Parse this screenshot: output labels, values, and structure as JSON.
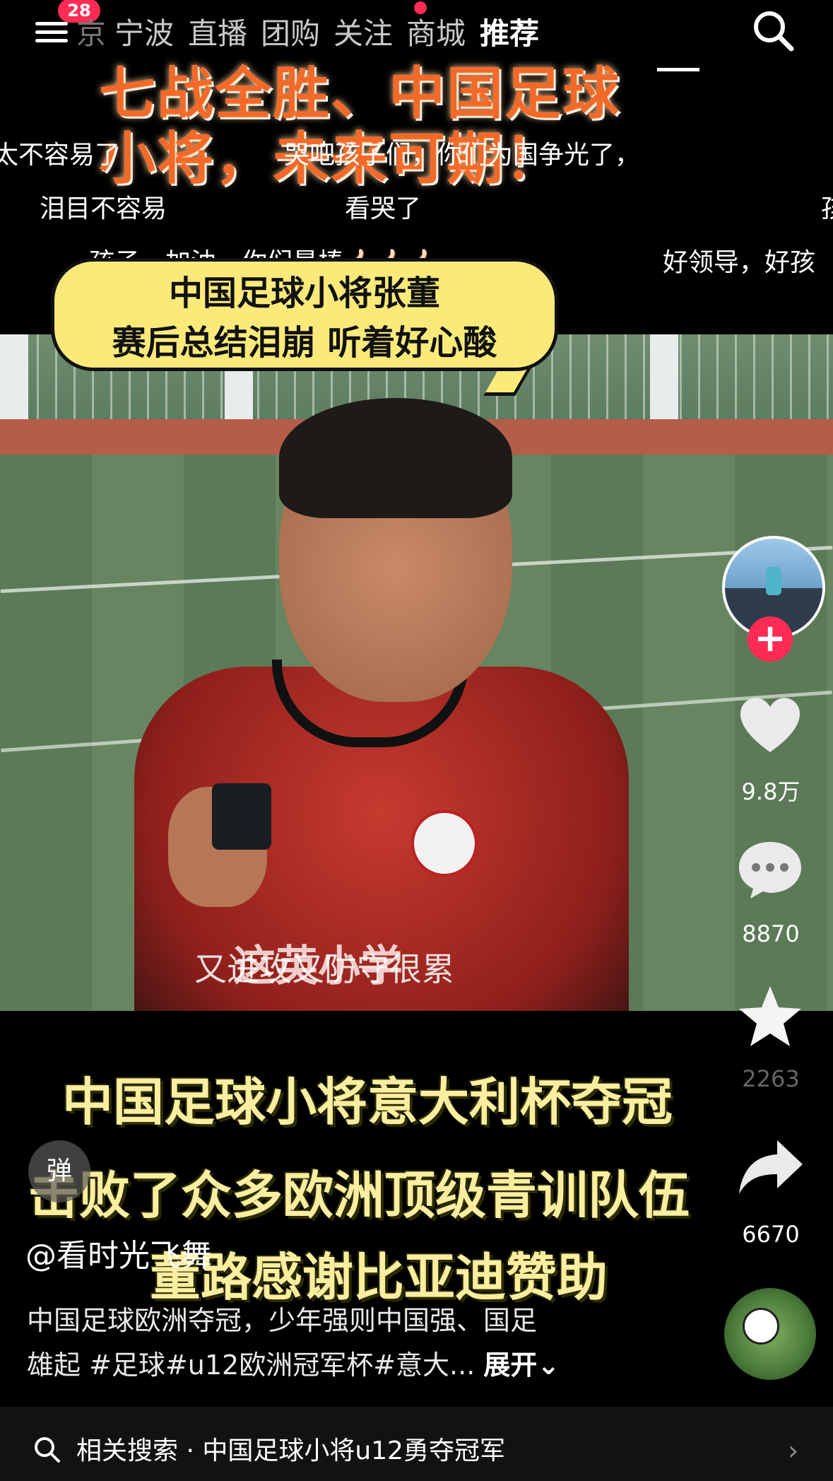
{
  "top_nav": {
    "notification_count": "28",
    "tabs": [
      "京",
      "宁波",
      "直播",
      "团购",
      "关注",
      "商城",
      "推荐"
    ],
    "active_tab": "推荐"
  },
  "overlay_title": {
    "line1": "七战全胜、中国足球",
    "line2": "小将，未来可期！"
  },
  "danmu": [
    "太不容易了",
    "哭吧孩子们，你们为国争光了，",
    "泪目不容易",
    "看哭了",
    "孩",
    "孩子，加油，你们最棒👍🏻👍🏻👍🏻",
    "好领导，好孩"
  ],
  "speech_bubble": {
    "line1": "中国足球小将张董",
    "line2": "赛后总结泪崩 听着好心酸"
  },
  "video_subtitle": "又进攻又防守很累",
  "jersey_text": "这英小学",
  "caption_lines": [
    "中国足球小将意大利杯夺冠",
    "击败了众多欧洲顶级青训队伍",
    "董路感谢比亚迪赞助"
  ],
  "right_rail": {
    "likes": "9.8万",
    "comments": "8870",
    "favorites": "2263",
    "shares": "6670"
  },
  "danmaku_button": "弹",
  "author": "@看时光飞舞",
  "description_line1": "中国足球欧洲夺冠，少年强则中国强、国足",
  "description_line2": "雄起 #足球#u12欧洲冠军杯#意大...",
  "expand_label": "展开",
  "related_search": {
    "label": "相关搜索 · 中国足球小将u12勇夺冠军"
  },
  "colors": {
    "accent_red": "#fe2c55",
    "headline_orange": "#f26a2a",
    "caption_yellow": "#fbeea0",
    "bubble_yellow": "#fbea7a"
  }
}
